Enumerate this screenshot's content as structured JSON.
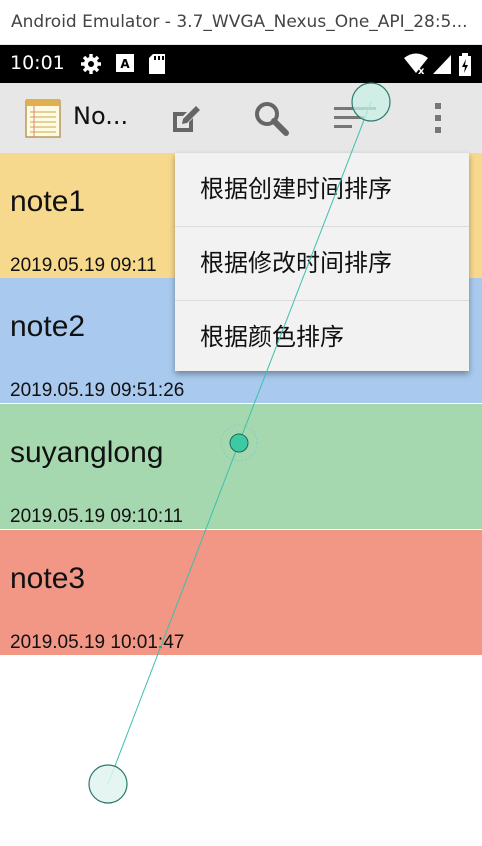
{
  "window": {
    "title": "Android Emulator - 3.7_WVGA_Nexus_One_API_28:5..."
  },
  "status_bar": {
    "time": "10:01"
  },
  "app_bar": {
    "title": "No..."
  },
  "notes": [
    {
      "title": "note1",
      "date": "2019.05.19 09:11",
      "color": "#f7d98e"
    },
    {
      "title": "note2",
      "date": "2019.05.19 09:51:26",
      "color": "#a9c9ee"
    },
    {
      "title": "suyanglong",
      "date": "2019.05.19 09:10:11",
      "color": "#a6d8b0"
    },
    {
      "title": "note3",
      "date": "2019.05.19 10:01:47",
      "color": "#f29686"
    }
  ],
  "menu": {
    "items": [
      {
        "label": "根据创建时间排序"
      },
      {
        "label": "根据修改时间排序"
      },
      {
        "label": "根据颜色排序"
      }
    ]
  },
  "icons": [
    "gear-icon",
    "a-icon",
    "sd-icon",
    "wifi-icon",
    "signal-icon",
    "battery-icon",
    "notepad-icon",
    "edit-icon",
    "search-icon",
    "sort-icon",
    "overflow-icon"
  ]
}
